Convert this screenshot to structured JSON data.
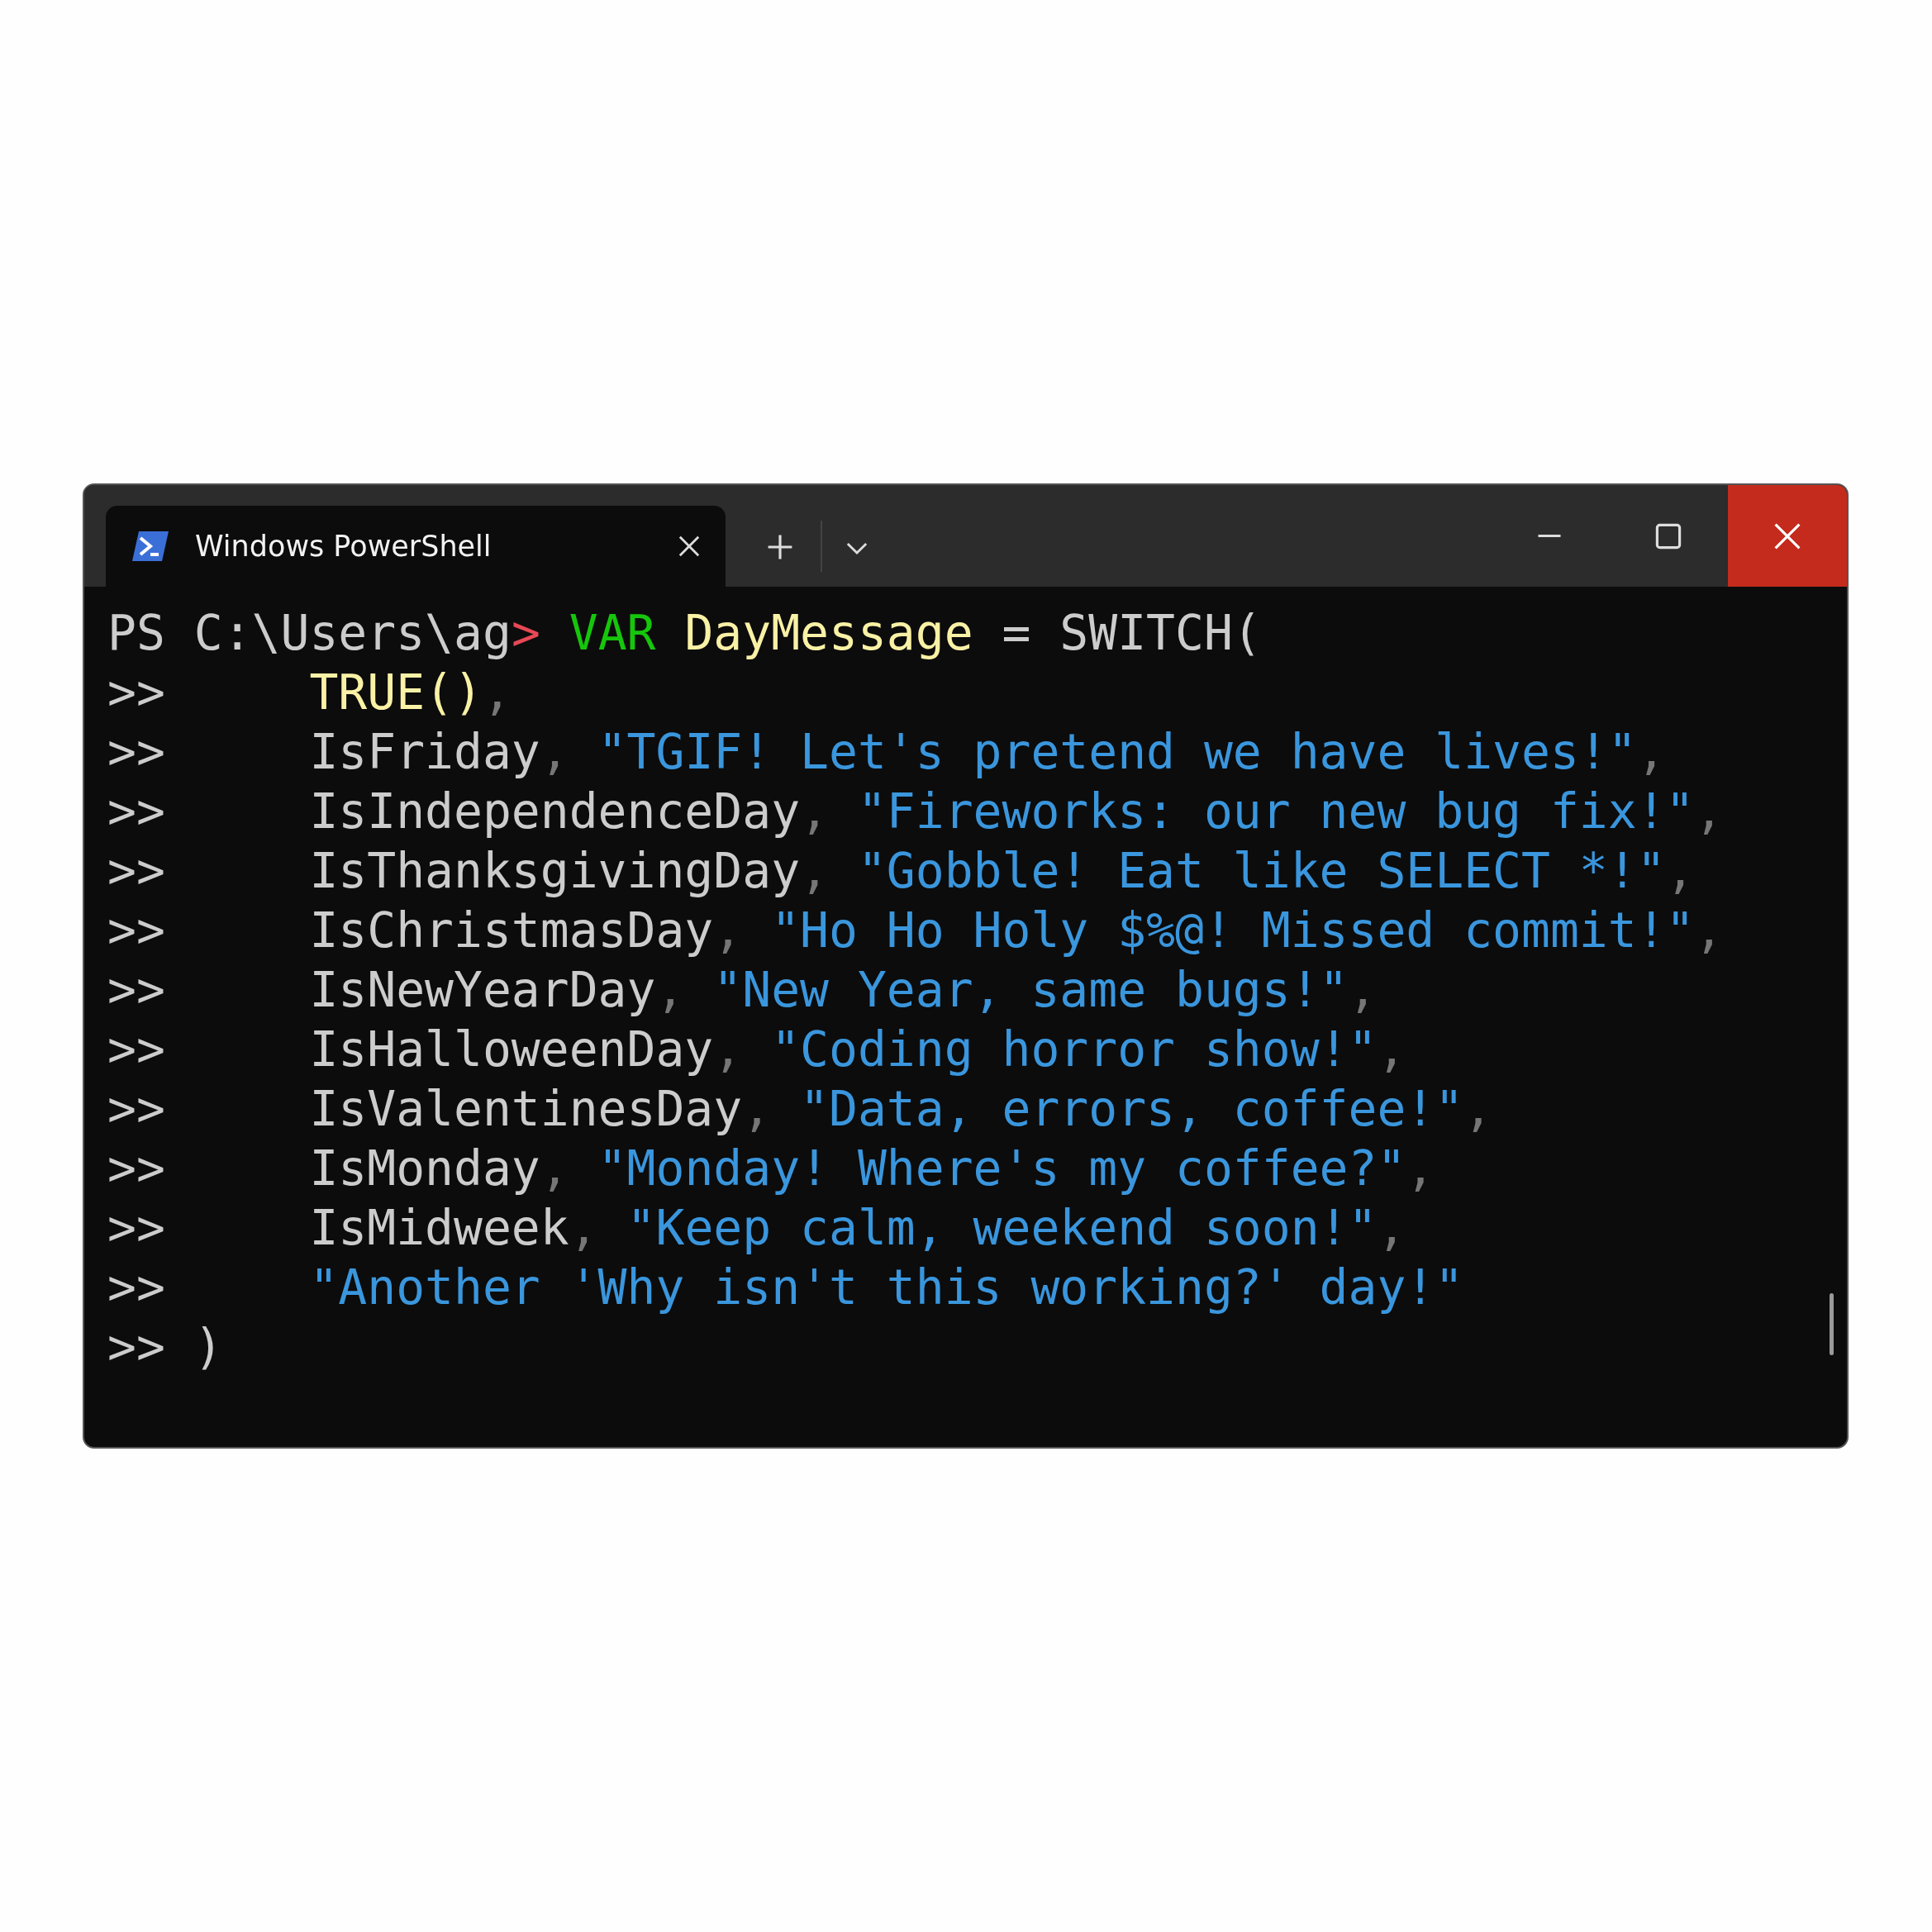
{
  "window": {
    "tab_title": "Windows PowerShell"
  },
  "terminal": {
    "lines": [
      {
        "prompt": "PS C:\\Users\\ag",
        "prompt_arrow": ">",
        "indent": false,
        "tokens": [
          {
            "kind": "keyword",
            "text": " VAR"
          },
          {
            "kind": "name",
            "text": " DayMessage"
          },
          {
            "kind": "plain",
            "text": " = SWITCH("
          }
        ]
      },
      {
        "prompt": ">>",
        "indent": true,
        "tokens": [
          {
            "kind": "name",
            "text": "TRUE()"
          },
          {
            "kind": "comma",
            "text": ","
          }
        ]
      },
      {
        "prompt": ">>",
        "indent": true,
        "tokens": [
          {
            "kind": "plain",
            "text": "IsFriday"
          },
          {
            "kind": "comma",
            "text": ","
          },
          {
            "kind": "string",
            "text": " \"TGIF! Let's pretend we have lives!\""
          },
          {
            "kind": "comma",
            "text": ","
          }
        ]
      },
      {
        "prompt": ">>",
        "indent": true,
        "tokens": [
          {
            "kind": "plain",
            "text": "IsIndependenceDay"
          },
          {
            "kind": "comma",
            "text": ","
          },
          {
            "kind": "string",
            "text": " \"Fireworks: our new bug fix!\""
          },
          {
            "kind": "comma",
            "text": ","
          }
        ]
      },
      {
        "prompt": ">>",
        "indent": true,
        "tokens": [
          {
            "kind": "plain",
            "text": "IsThanksgivingDay"
          },
          {
            "kind": "comma",
            "text": ","
          },
          {
            "kind": "string",
            "text": " \"Gobble! Eat like SELECT *!\""
          },
          {
            "kind": "comma",
            "text": ","
          }
        ]
      },
      {
        "prompt": ">>",
        "indent": true,
        "tokens": [
          {
            "kind": "plain",
            "text": "IsChristmasDay"
          },
          {
            "kind": "comma",
            "text": ","
          },
          {
            "kind": "string",
            "text": " \"Ho Ho Holy $%@! Missed commit!\""
          },
          {
            "kind": "comma",
            "text": ","
          }
        ]
      },
      {
        "prompt": ">>",
        "indent": true,
        "tokens": [
          {
            "kind": "plain",
            "text": "IsNewYearDay"
          },
          {
            "kind": "comma",
            "text": ","
          },
          {
            "kind": "string",
            "text": " \"New Year, same bugs!\""
          },
          {
            "kind": "comma",
            "text": ","
          }
        ]
      },
      {
        "prompt": ">>",
        "indent": true,
        "tokens": [
          {
            "kind": "plain",
            "text": "IsHalloweenDay"
          },
          {
            "kind": "comma",
            "text": ","
          },
          {
            "kind": "string",
            "text": " \"Coding horror show!\""
          },
          {
            "kind": "comma",
            "text": ","
          }
        ]
      },
      {
        "prompt": ">>",
        "indent": true,
        "tokens": [
          {
            "kind": "plain",
            "text": "IsValentinesDay"
          },
          {
            "kind": "comma",
            "text": ","
          },
          {
            "kind": "string",
            "text": " \"Data, errors, coffee!\""
          },
          {
            "kind": "comma",
            "text": ","
          }
        ]
      },
      {
        "prompt": ">>",
        "indent": true,
        "tokens": [
          {
            "kind": "plain",
            "text": "IsMonday"
          },
          {
            "kind": "comma",
            "text": ","
          },
          {
            "kind": "string",
            "text": " \"Monday! Where's my coffee?\""
          },
          {
            "kind": "comma",
            "text": ","
          }
        ]
      },
      {
        "prompt": ">>",
        "indent": true,
        "tokens": [
          {
            "kind": "plain",
            "text": "IsMidweek"
          },
          {
            "kind": "comma",
            "text": ","
          },
          {
            "kind": "string",
            "text": " \"Keep calm, weekend soon!\""
          },
          {
            "kind": "comma",
            "text": ","
          }
        ]
      },
      {
        "prompt": ">>",
        "indent": true,
        "tokens": [
          {
            "kind": "string",
            "text": "\"Another 'Why isn't this working?' day!\""
          }
        ]
      },
      {
        "prompt": ">>",
        "indent": false,
        "tokens": [
          {
            "kind": "plain",
            "text": " )"
          }
        ]
      }
    ]
  }
}
